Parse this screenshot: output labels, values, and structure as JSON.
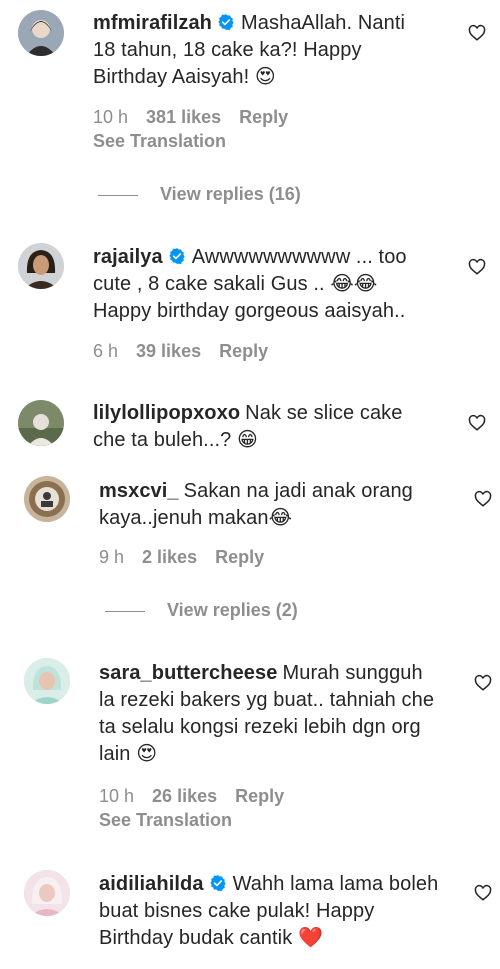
{
  "comments": [
    {
      "username": "mfmirafilzah",
      "verified": true,
      "text": "MashaAllah. Nanti 18 tahun, 18 cake ka?! Happy Birthday Aaisyah! 😍",
      "time": "10 h",
      "likes": "381 likes",
      "reply": "Reply",
      "see_translation": "See Translation",
      "view_replies": "View replies (16)"
    },
    {
      "username": "rajailya",
      "verified": true,
      "text": "Awwwwwwwwww ... too cute , 8 cake sakali Gus .. 😂😂 Happy birthday gorgeous aaisyah..",
      "time": "6 h",
      "likes": "39 likes",
      "reply": "Reply"
    },
    {
      "username": "lilylollipopxoxo",
      "verified": false,
      "text": "Nak se slice cake che ta buleh...? 😁"
    },
    {
      "username": "msxcvi_",
      "verified": false,
      "text": "Sakan na jadi anak orang kaya..jenuh makan😂",
      "time": "9 h",
      "likes": "2 likes",
      "reply": "Reply",
      "view_replies": "View replies (2)"
    },
    {
      "username": "sara_buttercheese",
      "verified": false,
      "text": "Murah sungguh la rezeki bakers yg buat.. tahniah che ta selalu kongsi rezeki lebih dgn org lain 😍",
      "time": "10 h",
      "likes": "26 likes",
      "reply": "Reply",
      "see_translation": "See Translation"
    },
    {
      "username": "aidiliahilda",
      "verified": true,
      "text": "Wahh lama lama boleh buat bisnes cake pulak! Happy Birthday budak cantik ❤️"
    }
  ],
  "icons": {
    "heart": "heart-outline-icon",
    "verified": "verified-badge-icon"
  },
  "colors": {
    "verified_blue": "#0095f6",
    "secondary_text": "#8e8e8e",
    "primary_text": "#262626"
  }
}
